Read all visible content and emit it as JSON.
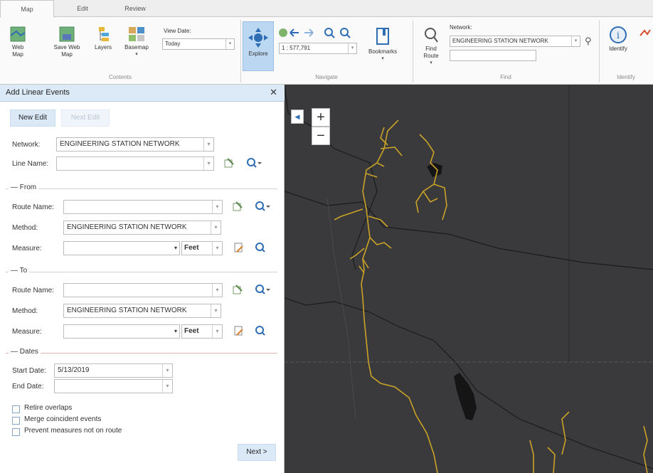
{
  "ribbon": {
    "tabs": [
      {
        "label": "Map",
        "active": true
      },
      {
        "label": "Edit",
        "active": false
      },
      {
        "label": "Review",
        "active": false
      }
    ],
    "contents": {
      "group_label": "Contents",
      "web_map": "Web Map",
      "save_web_map": "Save Web Map",
      "layers": "Layers",
      "basemap": "Basemap",
      "view_date_label": "View Date:",
      "view_date_value": "Today"
    },
    "navigate": {
      "group_label": "Navigate",
      "explore": "Explore",
      "scale": "1 : 577,791",
      "bookmarks": "Bookmarks"
    },
    "find": {
      "group_label": "Find",
      "find_route": "Find Route",
      "network_label": "Network:",
      "network_value": "ENGINEERING STATION NETWORK",
      "search_value": ""
    },
    "identify": {
      "group_label": "Identify",
      "identify": "Identify"
    }
  },
  "panel": {
    "title": "Add Linear Events",
    "close": "✕",
    "new_edit": "New Edit",
    "next_edit": "Next Edit",
    "network_label": "Network:",
    "network_value": "ENGINEERING STATION NETWORK",
    "line_name_label": "Line Name:",
    "line_name_value": "",
    "from": {
      "section": "From",
      "route_name_label": "Route Name:",
      "route_name_value": "",
      "method_label": "Method:",
      "method_value": "ENGINEERING STATION NETWORK",
      "measure_label": "Measure:",
      "measure_value": "",
      "unit": "Feet"
    },
    "to": {
      "section": "To",
      "route_name_label": "Route Name:",
      "route_name_value": "",
      "method_label": "Method:",
      "method_value": "ENGINEERING STATION NETWORK",
      "measure_label": "Measure:",
      "measure_value": "",
      "unit": "Feet"
    },
    "dates": {
      "section": "Dates",
      "start_label": "Start Date:",
      "start_value": "5/13/2019",
      "end_label": "End Date:",
      "end_value": ""
    },
    "options": [
      {
        "label": "Retire overlaps",
        "checked": false
      },
      {
        "label": "Merge coincident events",
        "checked": false
      },
      {
        "label": "Prevent measures not on route",
        "checked": false
      }
    ],
    "next": "Next >"
  },
  "map": {
    "zoom_in": "+",
    "zoom_out": "−",
    "collapse": "◀",
    "colors": {
      "background": "#3a3a3c",
      "route": "#c9a227",
      "border": "#1b1b1b"
    }
  }
}
